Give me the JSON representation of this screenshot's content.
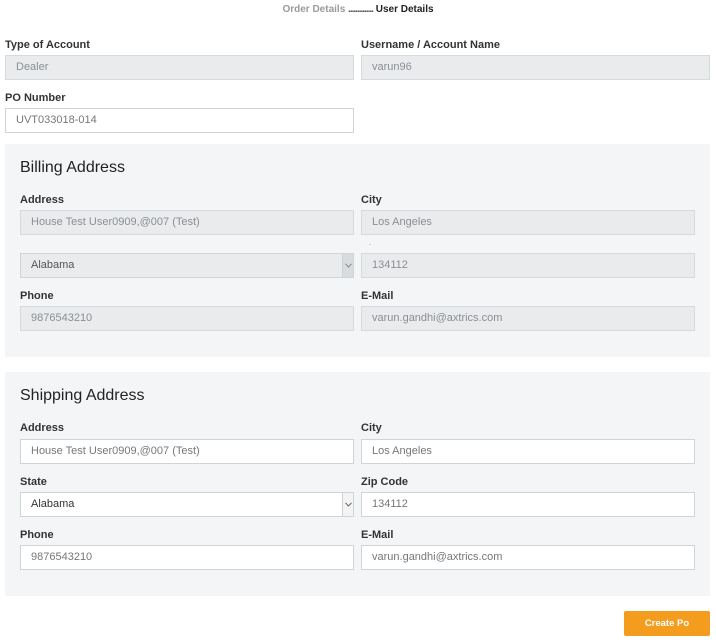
{
  "steps": {
    "order_details": "Order Details",
    "dots": "..............",
    "user_details": "User Details"
  },
  "account": {
    "type_label": "Type of Account",
    "type_value": "Dealer",
    "username_label": "Username / Account Name",
    "username_value": "varun96",
    "po_label": "PO Number",
    "po_value": "UVT033018-014"
  },
  "billing": {
    "title": "Billing Address",
    "address_label": "Address",
    "address_value": "House Test User0909,@007 (Test)",
    "city_label": "City",
    "city_value": "Los Angeles",
    "state_label": "",
    "state_value": "Alabama",
    "zip_label": ".",
    "zip_value": "134112",
    "phone_label": "Phone",
    "phone_value": "9876543210",
    "email_label": "E-Mail",
    "email_value": "varun.gandhi@axtrics.com"
  },
  "shipping": {
    "title": "Shipping Address",
    "address_label": "Address",
    "address_value": "House Test User0909,@007 (Test)",
    "city_label": "City",
    "city_value": "Los Angeles",
    "state_label": "State",
    "state_value": "Alabama",
    "zip_label": "Zip Code",
    "zip_value": "134112",
    "phone_label": "Phone",
    "phone_value": "9876543210",
    "email_label": "E-Mail",
    "email_value": "varun.gandhi@axtrics.com"
  },
  "actions": {
    "create_po": "Create Po"
  }
}
